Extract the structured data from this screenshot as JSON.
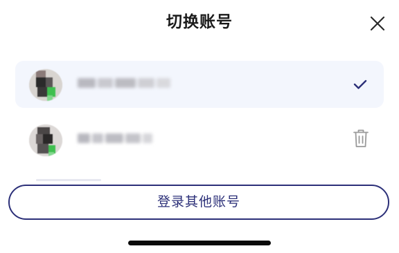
{
  "dialog": {
    "title": "切换账号",
    "close_icon": "close-icon"
  },
  "accounts": [
    {
      "display_name": "",
      "selected": true,
      "trailing_icon": "checkmark-icon"
    },
    {
      "display_name": "",
      "selected": false,
      "trailing_icon": "trash-icon"
    }
  ],
  "actions": {
    "login_other_label": "登录其他账号"
  },
  "colors": {
    "accent": "#2b2f78",
    "selected_row_bg": "#f3f6fd",
    "icon_gray": "#9a9a9a",
    "title_text": "#1a1a1a"
  }
}
